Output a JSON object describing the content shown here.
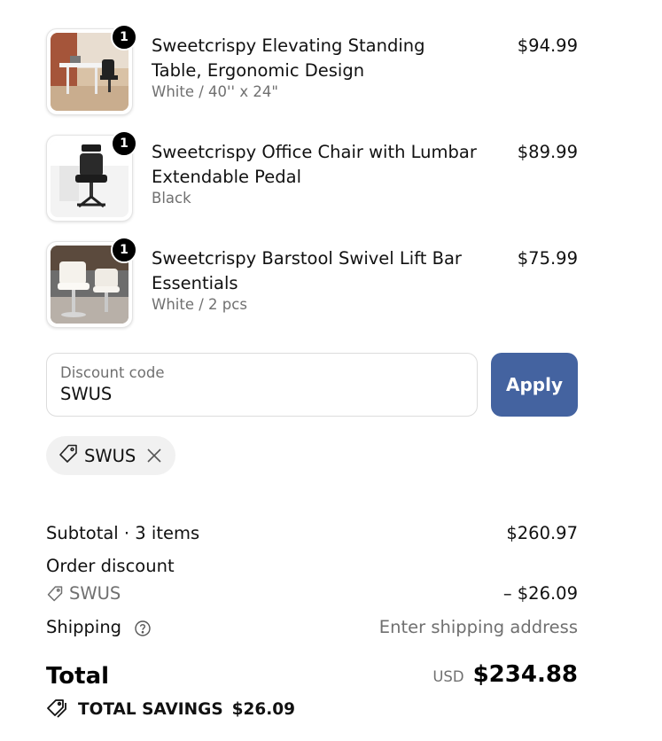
{
  "items": [
    {
      "title": "Sweetcrispy Elevating Standing Table, Ergonomic Design",
      "variant": "White / 40'' x 24\"",
      "price": "$94.99",
      "quantity": "1"
    },
    {
      "title": "Sweetcrispy Office Chair with Lumbar Extendable Pedal",
      "variant": "Black",
      "price": "$89.99",
      "quantity": "1"
    },
    {
      "title": "Sweetcrispy Barstool Swivel Lift Bar Essentials",
      "variant": "White / 2 pcs",
      "price": "$75.99",
      "quantity": "1"
    }
  ],
  "discount": {
    "label": "Discount code",
    "value": "SWUS",
    "apply_label": "Apply",
    "applied_code": "SWUS"
  },
  "summary": {
    "subtotal_label": "Subtotal · 3 items",
    "subtotal_value": "$260.97",
    "order_discount_label": "Order discount",
    "order_discount_code": "SWUS",
    "order_discount_value": "– $26.09",
    "shipping_label": "Shipping",
    "shipping_value": "Enter shipping address",
    "total_label": "Total",
    "currency": "USD",
    "total_value": "$234.88",
    "savings_label": "TOTAL SAVINGS",
    "savings_value": "$26.09"
  },
  "colors": {
    "apply_button": "#4463a0",
    "chip_background": "#f1f1f1",
    "muted_text": "#707070"
  },
  "icons": {
    "discount_tag": "tag-icon",
    "remove": "close-icon",
    "help": "help-circle-icon",
    "savings": "tags-icon"
  }
}
